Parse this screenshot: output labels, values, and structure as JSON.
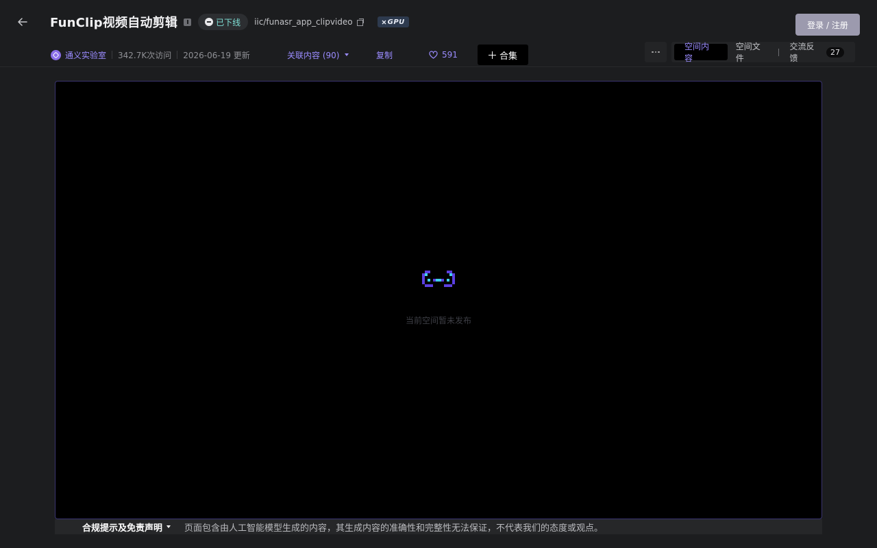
{
  "header": {
    "title": "FunClip视频自动剪辑",
    "status_label": "已下线",
    "repo_path": "iic/funasr_app_clipvideo",
    "gpu_badge": "GPU",
    "login_label": "登录 / 注册"
  },
  "meta": {
    "org_name": "通义实验室",
    "visits": "342.7K次访问",
    "updated": "2026-06-19 更新",
    "related_label": "关联内容 (90)",
    "duplicate_label": "复制",
    "likes": "591",
    "collect_label": "合集"
  },
  "tabs": [
    {
      "label": "空间内容",
      "active": true
    },
    {
      "label": "空间文件",
      "active": false
    },
    {
      "label": "交流反馈",
      "active": false,
      "count": "27"
    }
  ],
  "main": {
    "empty_message": "当前空间暂未发布"
  },
  "footer": {
    "title": "合规提示及免责声明",
    "disclaimer": "页面包含由人工智能模型生成的内容，其生成内容的准确性和完整性无法保证，不代表我们的态度或观点。"
  },
  "colors": {
    "accent": "#9b8cff",
    "status_green": "#7fe0d6",
    "frame_border": "#3a3470"
  }
}
